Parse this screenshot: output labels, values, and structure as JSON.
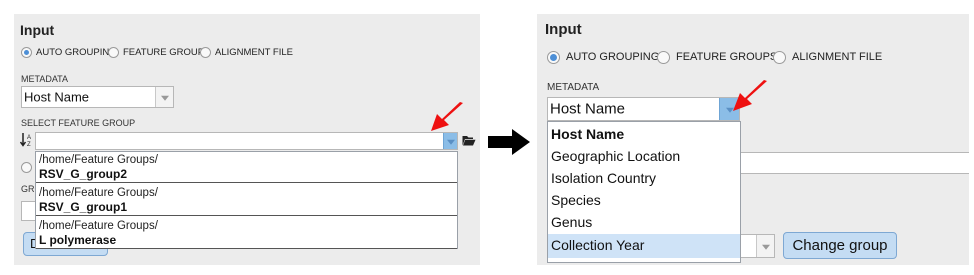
{
  "left": {
    "title": "Input",
    "radios": [
      {
        "label": "AUTO GROUPING",
        "checked": true
      },
      {
        "label": "FEATURE GROUPS",
        "checked": false
      },
      {
        "label": "ALIGNMENT FILE",
        "checked": false
      }
    ],
    "metadata_label": "METADATA",
    "metadata_value": "Host Name",
    "feature_group_label": "SELECT FEATURE GROUP",
    "sort_icon_text": "A↓Z",
    "feature_group_value": "",
    "feature_groups": [
      {
        "path": "/home/Feature Groups/",
        "name": "RSV_G_group2"
      },
      {
        "path": "/home/Feature Groups/",
        "name": "RSV_G_group1"
      },
      {
        "path": "/home/Feature Groups/",
        "name": "L polymerase"
      }
    ],
    "obscured_label": "GRO",
    "obscured_button": "D"
  },
  "right": {
    "title": "Input",
    "radios": [
      {
        "label": "AUTO GROUPING",
        "checked": true
      },
      {
        "label": "FEATURE GROUPS",
        "checked": false
      },
      {
        "label": "ALIGNMENT FILE",
        "checked": false
      }
    ],
    "metadata_label": "METADATA",
    "metadata_value": "Host Name",
    "options": [
      "Host Name",
      "Geographic Location",
      "Isolation Country",
      "Species",
      "Genus",
      "Collection Year"
    ],
    "selected_option": "Host Name",
    "highlighted_option": "Collection Year",
    "change_group_label": "Change group"
  },
  "colors": {
    "panel_bg": "#ececec",
    "radio_checked": "#4d8fd6",
    "pointer_arrow": "#ee1111",
    "transition_arrow": "#000000",
    "button_bg": "#c4dcf3",
    "highlight_bg": "#cfe3f7"
  }
}
